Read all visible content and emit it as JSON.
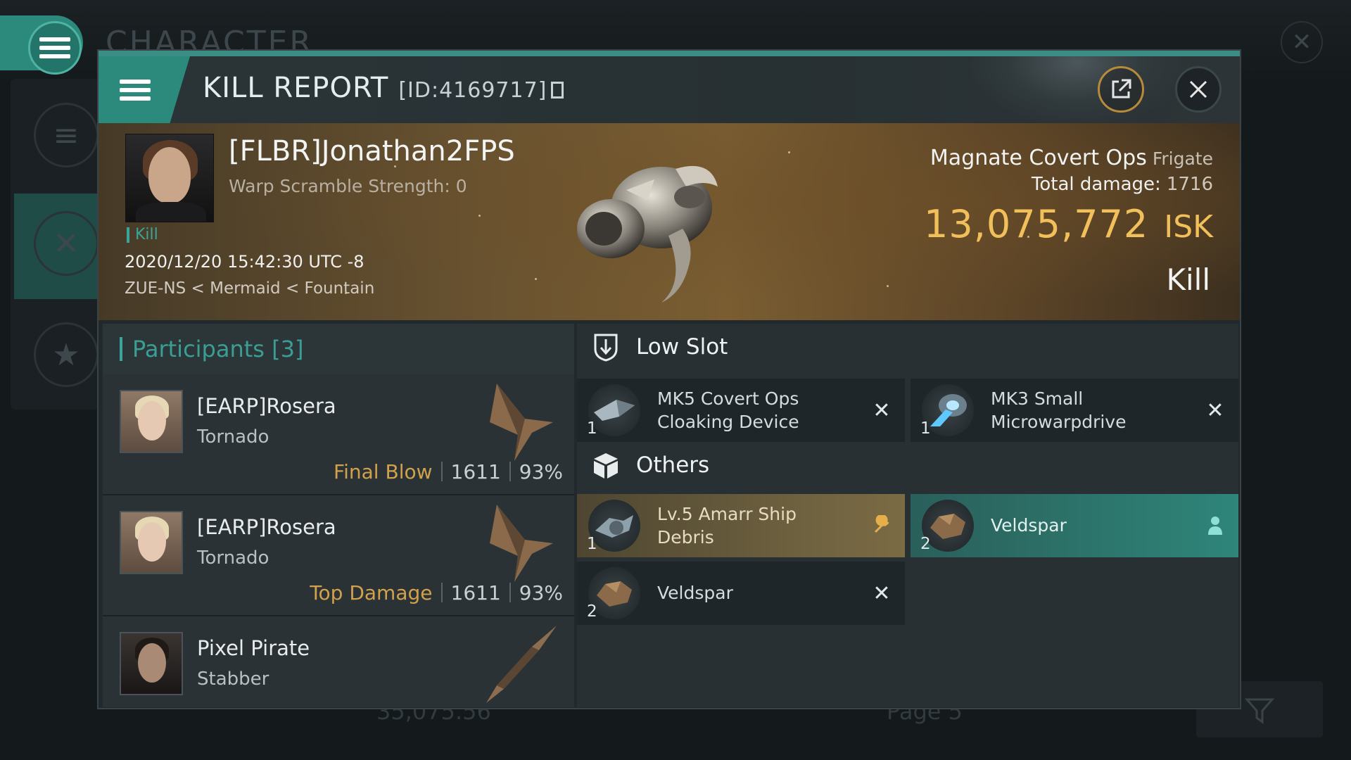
{
  "background": {
    "title": "CHARACTER"
  },
  "modal": {
    "title": "KILL REPORT",
    "id_text": "[ID:4169717]"
  },
  "victim": {
    "name": "[FLBR]Jonathan2FPS",
    "warp_scramble": "Warp Scramble Strength: 0",
    "tag": "Kill",
    "datetime": "2020/12/20 15:42:30 UTC -8",
    "location": "ZUE-NS < Mermaid < Fountain",
    "ship_name": "Magnate Covert Ops",
    "ship_class": "Frigate",
    "total_damage_label": "Total damage:",
    "total_damage": "1716",
    "isk_value": "13,075,772",
    "isk_unit": "ISK",
    "result": "Kill"
  },
  "participants": {
    "header": "Participants [3]",
    "rows": [
      {
        "name": "[EARP]Rosera",
        "ship": "Tornado",
        "role": "Final Blow",
        "damage": "1611",
        "percent": "93%"
      },
      {
        "name": "[EARP]Rosera",
        "ship": "Tornado",
        "role": "Top Damage",
        "damage": "1611",
        "percent": "93%"
      },
      {
        "name": "Pixel Pirate",
        "ship": "Stabber"
      }
    ]
  },
  "sections": {
    "low_slot": "Low Slot",
    "others": "Others"
  },
  "items": {
    "low_slot": [
      {
        "name_line1": "MK5 Covert Ops",
        "name_line2": "Cloaking Device",
        "qty": "1",
        "status": "destroyed"
      },
      {
        "name_line1": "MK3 Small",
        "name_line2": "Microwarpdrive",
        "qty": "1",
        "status": "destroyed"
      }
    ],
    "others": [
      {
        "name_line1": "Lv.5 Amarr Ship",
        "name_line2": "Debris",
        "qty": "1",
        "status": "dropped"
      },
      {
        "name_line1": "Veldspar",
        "qty": "2",
        "status": "looted"
      },
      {
        "name_line1": "Veldspar",
        "qty": "2",
        "status": "destroyed"
      }
    ]
  },
  "bottom_bar": {
    "value": "35,075.56",
    "page_label": "Page 5"
  },
  "colors": {
    "accent_teal": "#2c8a7c",
    "isk_gold": "#f2c05a",
    "role_orange": "#d2a14c"
  },
  "icons": {
    "share": "share-icon",
    "close": "close-icon",
    "low_slot": "low-slot-icon",
    "others": "cargo-box-icon",
    "destroyed": "x-icon",
    "dropped": "wrench-icon",
    "looted": "person-icon"
  }
}
